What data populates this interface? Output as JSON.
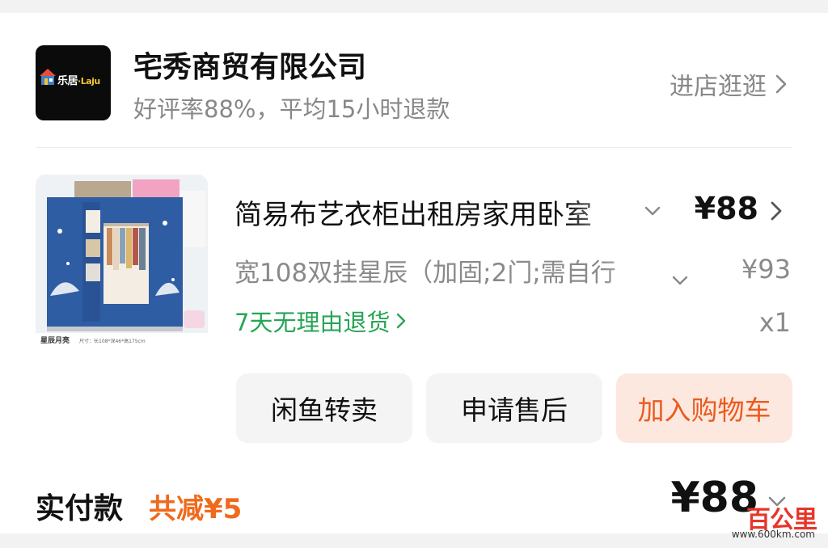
{
  "shop": {
    "logo_text": "乐居",
    "logo_text_en": "·Laju",
    "name": "宅秀商贸有限公司",
    "rating": "好评率88%，平均15小时退款",
    "enter_label": "进店逛逛"
  },
  "product": {
    "title": "简易布艺衣柜出租房家用卧室",
    "price": "¥88",
    "spec": "宽108双挂星辰（加固;2门;需自行",
    "original_price": "¥93",
    "return_policy": "7天无理由退货",
    "quantity": "x1",
    "image": {
      "caption_name": "星辰月亮",
      "caption_size": "尺寸：长108*深46*高175cm"
    }
  },
  "actions": {
    "xianyu": "闲鱼转卖",
    "after_sale": "申请售后",
    "add_to_cart": "加入购物车"
  },
  "summary": {
    "paid_label": "实付款",
    "discount": "共减¥5",
    "total": "¥88"
  },
  "watermark": {
    "main": "百公里",
    "url": "www.600km.com"
  },
  "colors": {
    "return_green": "#27a556",
    "discount_orange": "#ef6a1c",
    "cart_button_bg": "#fde8df",
    "cart_button_text": "#ea5b1f",
    "watermark_red": "#e8352a"
  }
}
